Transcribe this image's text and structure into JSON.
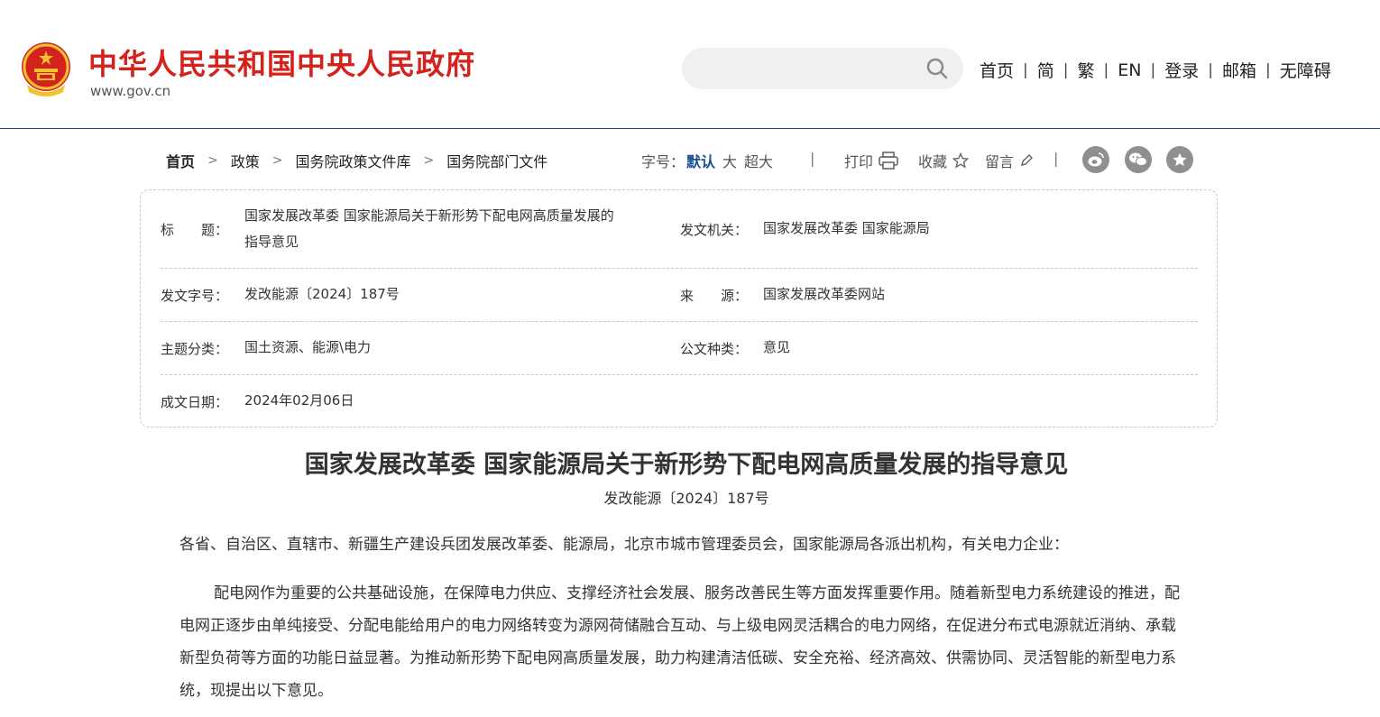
{
  "header": {
    "site_name": "中华人民共和国中央人民政府",
    "site_domain": "www.gov.cn",
    "search_placeholder": "",
    "nav": [
      "首页",
      "简",
      "繁",
      "EN",
      "登录",
      "邮箱",
      "无障碍"
    ],
    "brand_color": "#d4221c"
  },
  "breadcrumb": {
    "items": [
      "首页",
      "政策",
      "国务院政策文件库",
      "国务院部门文件"
    ]
  },
  "toolbar": {
    "font_size_label": "字号：",
    "font_options": [
      "默认",
      "大",
      "超大"
    ],
    "print_label": "打印",
    "favorite_label": "收藏",
    "comment_label": "留言",
    "share_icons": [
      "weibo-icon",
      "wechat-icon",
      "star-share-icon"
    ]
  },
  "info": {
    "title_label": "标　　题：",
    "title_value": "国家发展改革委 国家能源局关于新形势下配电网高质量发展的指导意见",
    "title_line1": "国家发展改革委  国家能源局关于新形势下配电网高质量发展的",
    "title_line2": "指导意见",
    "issuer_label": "发文机关：",
    "issuer_value": "国家发展改革委  国家能源局",
    "docno_label": "发文字号：",
    "docno_value": "发改能源〔2024〕187号",
    "source_label": "来　　源：",
    "source_value": "国家发展改革委网站",
    "topic_label": "主题分类：",
    "topic_value": "国土资源、能源\\电力",
    "type_label": "公文种类：",
    "type_value": "意见",
    "date_label": "成文日期：",
    "date_value": "2024年02月06日"
  },
  "article": {
    "title": "国家发展改革委  国家能源局关于新形势下配电网高质量发展的指导意见",
    "doc_number": "发改能源〔2024〕187号",
    "recipients": "各省、自治区、直辖市、新疆生产建设兵团发展改革委、能源局，北京市城市管理委员会，国家能源局各派出机构，有关电力企业：",
    "paragraph1": "配电网作为重要的公共基础设施，在保障电力供应、支撑经济社会发展、服务改善民生等方面发挥重要作用。随着新型电力系统建设的推进，配电网正逐步由单纯接受、分配电能给用户的电力网络转变为源网荷储融合互动、与上级电网灵活耦合的电力网络，在促进分布式电源就近消纳、承载新型负荷等方面的功能日益显著。为推动新形势下配电网高质量发展，助力构建清洁低碳、安全充裕、经济高效、供需协同、灵活智能的新型电力系统，现提出以下意见。"
  }
}
